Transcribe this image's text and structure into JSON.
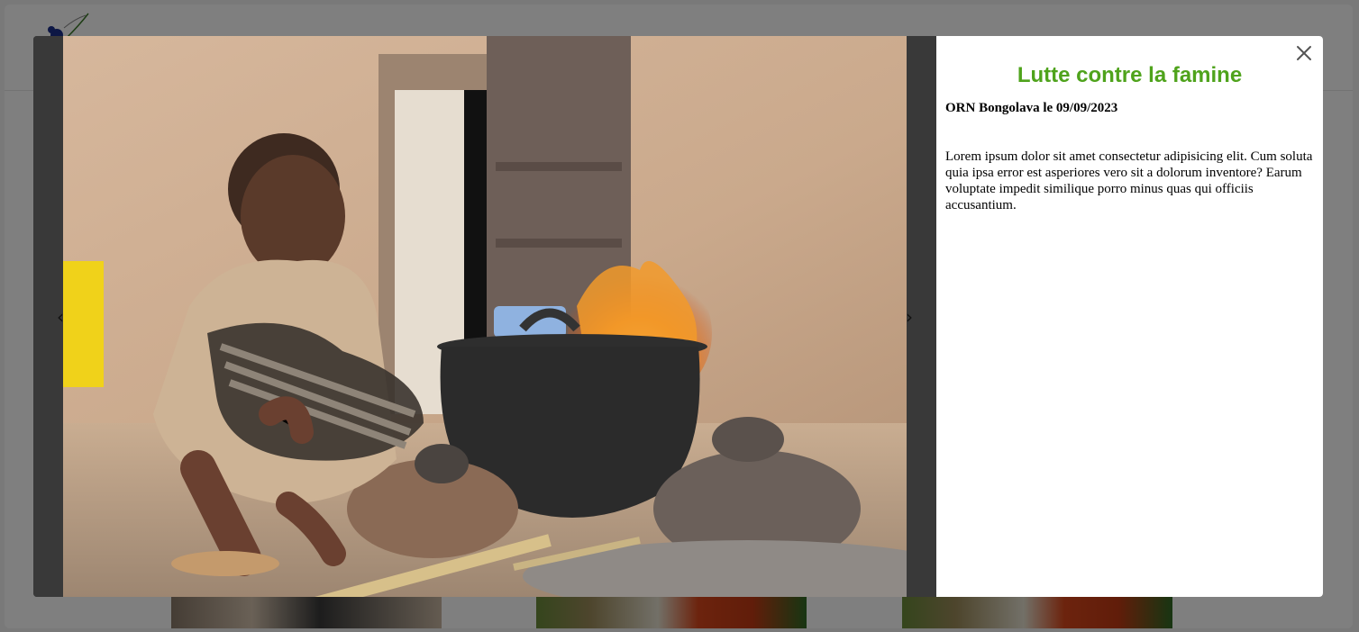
{
  "modal": {
    "title": "Lutte contre la famine",
    "meta": "ORN Bongolava le 09/09/2023",
    "description": "Lorem ipsum dolor sit amet consectetur adipisicing elit. Cum soluta quia ipsa error est asperiores vero sit a dolorum inventore? Earum voluptate impedit similique porro minus quas qui officiis accusantium.",
    "prev_label": "‹",
    "next_label": "›",
    "title_color": "#4fa31c"
  },
  "icons": {
    "close": "close-icon",
    "logo": "organization-logo"
  }
}
